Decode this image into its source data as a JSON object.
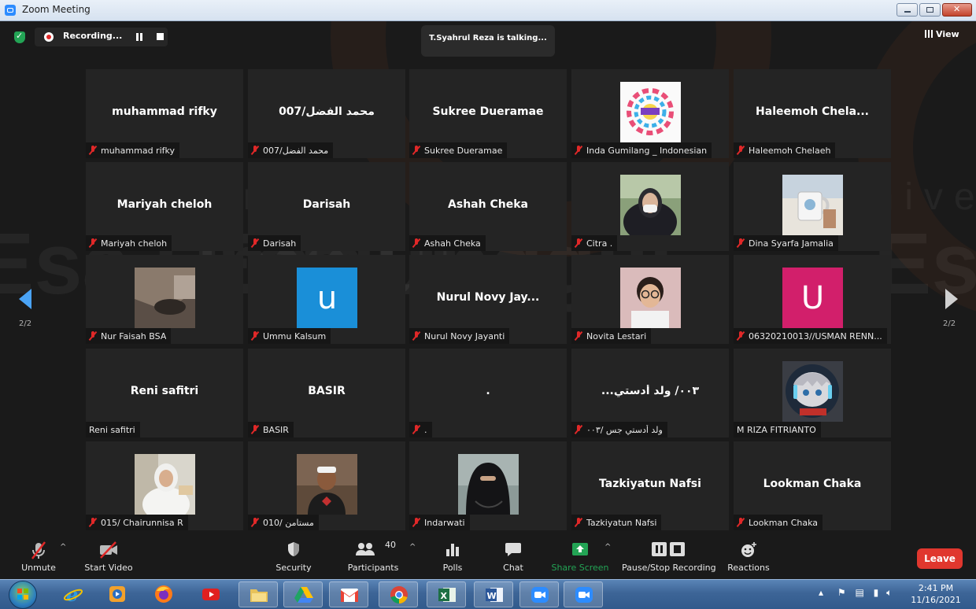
{
  "window": {
    "title": "Zoom Meeting"
  },
  "topbar": {
    "recording_label": "Recording...",
    "talking": "T.Syahrul Reza is talking...",
    "view_label": "View"
  },
  "pages": {
    "left": "2/2",
    "right": "2/2"
  },
  "background_watermark": {
    "line1": "Universitas",
    "line2": "Esa Unggul"
  },
  "participants": [
    {
      "display": "muhammad rifky",
      "label": "muhammad rifky",
      "muted": true
    },
    {
      "display": "محمد الفضل/007",
      "label": "محمد الفضل/007",
      "muted": true
    },
    {
      "display": "Sukree Dueramae",
      "label": "Sukree Dueramae",
      "muted": true
    },
    {
      "display": "",
      "label": "Inda Gumilang _ Indonesian",
      "muted": true,
      "photo": "tolerance-poster"
    },
    {
      "display": "Haleemoh  Chela...",
      "label": "Haleemoh Chelaeh",
      "muted": true
    },
    {
      "display": "Mariyah cheloh",
      "label": "Mariyah cheloh",
      "muted": true
    },
    {
      "display": "Darisah",
      "label": "Darisah",
      "muted": true
    },
    {
      "display": "Ashah Cheka",
      "label": "Ashah Cheka",
      "muted": true
    },
    {
      "display": "",
      "label": "Citra .",
      "muted": true,
      "photo": "hijab-mask"
    },
    {
      "display": "",
      "label": "Dina Syarfa Jamalia",
      "muted": true,
      "photo": "mug"
    },
    {
      "display": "",
      "label": "Nur Faisah BSA",
      "muted": true,
      "photo": "dark-photo"
    },
    {
      "display": "",
      "label": "Ummu Kalsum",
      "muted": true,
      "avatar": {
        "letter": "u",
        "color": "#1a8fd8"
      }
    },
    {
      "display": "Nurul Novy Jay...",
      "label": "Nurul Novy Jayanti",
      "muted": true
    },
    {
      "display": "",
      "label": "Novita Lestari",
      "muted": true,
      "photo": "glasses-portrait"
    },
    {
      "display": "",
      "label": "06320210013//USMAN RENN...",
      "muted": true,
      "avatar": {
        "letter": "U",
        "color": "#d21f6b"
      }
    },
    {
      "display": "Reni safitri",
      "label": "Reni safitri",
      "muted": false
    },
    {
      "display": "BASIR",
      "label": "BASIR",
      "muted": true
    },
    {
      "display": ".",
      "label": ".",
      "muted": true
    },
    {
      "display": "...٠٠٣/ ولد أدستي",
      "label": "ولد أدستي جس /٠٠٣",
      "muted": true
    },
    {
      "display": "",
      "label": "M RIZA FITRIANTO",
      "muted": false,
      "photo": "anime-avatar"
    },
    {
      "display": "",
      "label": "015/ Chairunnisa R",
      "muted": true,
      "photo": "white-hijab"
    },
    {
      "display": "",
      "label": "010/ مستامن",
      "muted": true,
      "photo": "cap-portrait"
    },
    {
      "display": "",
      "label": "Indarwati",
      "muted": true,
      "photo": "black-niqab"
    },
    {
      "display": "Tazkiyatun Nafsi",
      "label": "Tazkiyatun Nafsi",
      "muted": true
    },
    {
      "display": "Lookman Chaka",
      "label": "Lookman Chaka",
      "muted": true
    }
  ],
  "toolbar": {
    "unmute": "Unmute",
    "start_video": "Start Video",
    "security": "Security",
    "participants": "Participants",
    "participant_count": "40",
    "polls": "Polls",
    "chat": "Chat",
    "share_screen": "Share Screen",
    "pause_stop_recording": "Pause/Stop Recording",
    "reactions": "Reactions",
    "leave": "Leave"
  },
  "colors": {
    "share_green": "#23a455",
    "leave_red": "#e0372e",
    "mute_red": "#e02828"
  },
  "taskbar": {
    "time": "2:41 PM",
    "date": "11/16/2021"
  }
}
